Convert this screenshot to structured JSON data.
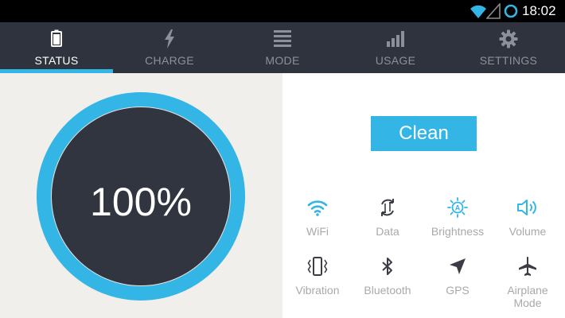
{
  "status_bar": {
    "time": "18:02",
    "icons": [
      "wifi-icon",
      "signal-icon",
      "sync-icon"
    ]
  },
  "tabs": [
    {
      "label": "STATUS",
      "icon": "battery-icon",
      "active": true
    },
    {
      "label": "CHARGE",
      "icon": "lightning-icon",
      "active": false
    },
    {
      "label": "MODE",
      "icon": "list-icon",
      "active": false
    },
    {
      "label": "USAGE",
      "icon": "bar-chart-icon",
      "active": false
    },
    {
      "label": "SETTINGS",
      "icon": "gear-icon",
      "active": false
    }
  ],
  "battery": {
    "level_text": "100%",
    "level_fraction": 1.0
  },
  "clean_button": {
    "label": "Clean"
  },
  "toggles": [
    {
      "label": "WiFi",
      "icon": "wifi-icon",
      "active": true
    },
    {
      "label": "Data",
      "icon": "data-sync-icon",
      "active": false
    },
    {
      "label": "Brightness",
      "icon": "brightness-icon",
      "active": true
    },
    {
      "label": "Volume",
      "icon": "volume-icon",
      "active": true
    },
    {
      "label": "Vibration",
      "icon": "vibration-icon",
      "active": false
    },
    {
      "label": "Bluetooth",
      "icon": "bluetooth-icon",
      "active": false
    },
    {
      "label": "GPS",
      "icon": "gps-icon",
      "active": false
    },
    {
      "label": "Airplane\nMode",
      "icon": "airplane-icon",
      "active": false
    }
  ],
  "colors": {
    "accent": "#33b5e5",
    "tabbar": "#2e333d",
    "gauge_face": "#313540",
    "inactive_icon": "#3a3d44",
    "label_gray": "#a9a9a9"
  }
}
